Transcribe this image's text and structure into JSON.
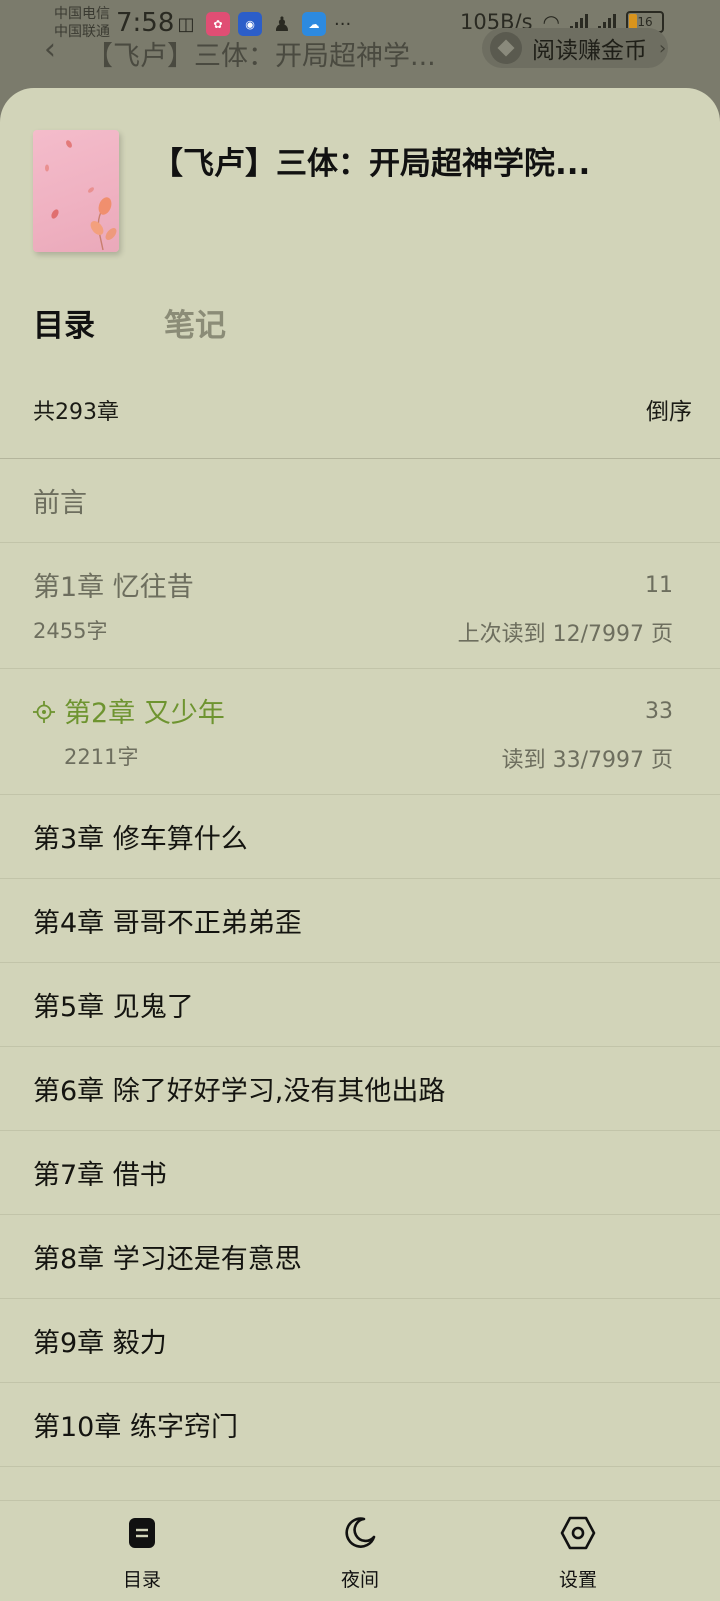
{
  "status_bar": {
    "carrier1": "中国电信",
    "carrier2": "中国联通",
    "time": "7:58",
    "speed": "105B/s",
    "battery": "16",
    "more": "···"
  },
  "header": {
    "back_icon": "chevron-left-icon",
    "title": "【飞卢】三体：开局超神学...",
    "earn_label": "阅读赚金币"
  },
  "book": {
    "title": "【飞卢】三体：开局超神学院..."
  },
  "tabs": [
    {
      "label": "目录",
      "active": true
    },
    {
      "label": "笔记",
      "active": false
    }
  ],
  "toc": {
    "count": "共293章",
    "order_label": "倒序"
  },
  "chapters": [
    {
      "title": "前言",
      "kind": "read"
    },
    {
      "title": "第1章 忆往昔",
      "kind": "read-detail",
      "page": "11",
      "words": "2455字",
      "progress": "上次读到 12/7997 页"
    },
    {
      "title": "第2章 又少年",
      "kind": "current",
      "page": "33",
      "words": "2211字",
      "progress": "读到 33/7997 页"
    },
    {
      "title": "第3章 修车算什么",
      "kind": "normal"
    },
    {
      "title": "第4章 哥哥不正弟弟歪",
      "kind": "normal"
    },
    {
      "title": "第5章 见鬼了",
      "kind": "normal"
    },
    {
      "title": "第6章 除了好好学习,没有其他出路",
      "kind": "normal"
    },
    {
      "title": "第7章 借书",
      "kind": "normal"
    },
    {
      "title": "第8章 学习还是有意思",
      "kind": "normal"
    },
    {
      "title": "第9章 毅力",
      "kind": "normal"
    },
    {
      "title": "第10章 练字窍门",
      "kind": "normal"
    }
  ],
  "bottom_nav": [
    {
      "label": "目录",
      "icon": "toc-icon"
    },
    {
      "label": "夜间",
      "icon": "moon-icon"
    },
    {
      "label": "设置",
      "icon": "settings-hexagon-icon"
    }
  ],
  "colors": {
    "sheet_bg": "#d2d4b9",
    "accent_current": "#6e9430",
    "dim_overlay": "#7b7b6c"
  }
}
